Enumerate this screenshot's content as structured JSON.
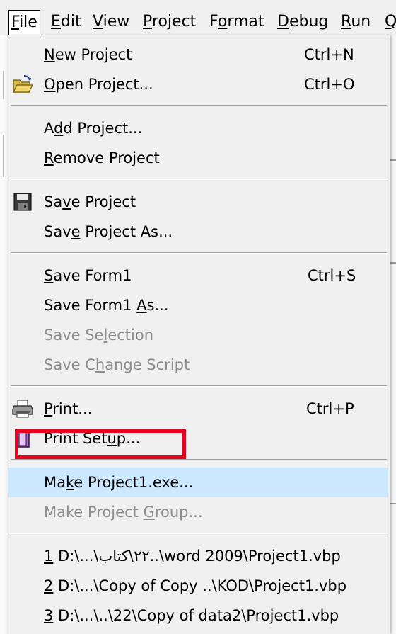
{
  "menubar": {
    "items": [
      {
        "prefix": "",
        "u": "F",
        "suffix": "ile",
        "active": true
      },
      {
        "prefix": "",
        "u": "E",
        "suffix": "dit"
      },
      {
        "prefix": "",
        "u": "V",
        "suffix": "iew"
      },
      {
        "prefix": "",
        "u": "P",
        "suffix": "roject"
      },
      {
        "prefix": "F",
        "u": "o",
        "suffix": "rmat"
      },
      {
        "prefix": "",
        "u": "D",
        "suffix": "ebug"
      },
      {
        "prefix": "",
        "u": "R",
        "suffix": "un"
      },
      {
        "prefix": "",
        "u": "Q",
        "suffix": ""
      }
    ]
  },
  "file_menu": {
    "new_project": {
      "pre": "",
      "u": "N",
      "post": "ew Project",
      "shortcut": "Ctrl+N"
    },
    "open_project": {
      "pre": "",
      "u": "O",
      "post": "pen Project...",
      "shortcut": "Ctrl+O",
      "icon": "open-folder-icon"
    },
    "add_project": {
      "pre": "A",
      "u": "d",
      "post": "d Project..."
    },
    "remove_project": {
      "pre": "",
      "u": "R",
      "post": "emove Project"
    },
    "save_project": {
      "pre": "Sa",
      "u": "v",
      "post": "e Project",
      "icon": "floppy-disk-icon"
    },
    "save_project_as": {
      "pre": "Sav",
      "u": "e",
      "post": " Project As..."
    },
    "save_form": {
      "pre": "",
      "u": "S",
      "post": "ave Form1",
      "shortcut": "Ctrl+S"
    },
    "save_form_as": {
      "pre": "Save Form1 ",
      "u": "A",
      "post": "s..."
    },
    "save_selection": {
      "pre": "Save Se",
      "u": "l",
      "post": "ection",
      "disabled": true
    },
    "save_change_script": {
      "pre": "Save C",
      "u": "h",
      "post": "ange Script",
      "disabled": true
    },
    "print": {
      "pre": "",
      "u": "P",
      "post": "rint...",
      "shortcut": "Ctrl+P",
      "icon": "printer-icon"
    },
    "print_setup": {
      "pre": "Print Set",
      "u": "u",
      "post": "p...",
      "icon": "print-setup-icon"
    },
    "make_exe": {
      "pre": "Ma",
      "u": "k",
      "post": "e Project1.exe...",
      "highlighted": true
    },
    "make_group": {
      "pre": "Make Project ",
      "u": "G",
      "post": "roup...",
      "disabled": true
    },
    "mru1": {
      "num": "1",
      "path": " D:\\...\\٢٢\\كتاب..\\word 2009\\Project1.vbp"
    },
    "mru2": {
      "num": "2",
      "path": " D:\\...\\Copy of Copy ..\\KOD\\Project1.vbp"
    },
    "mru3": {
      "num": "3",
      "path": " D:\\...\\..\\22\\Copy of data2\\Project1.vbp"
    }
  }
}
